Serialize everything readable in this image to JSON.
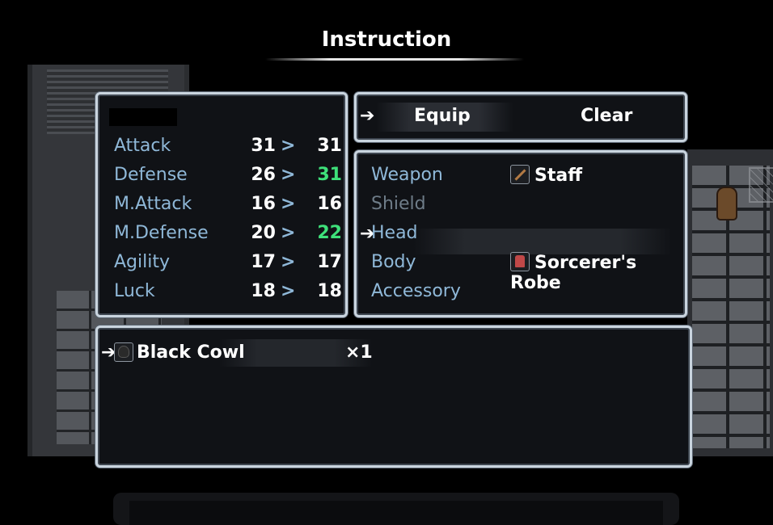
{
  "screen_title": "Instruction",
  "status": {
    "stats": [
      {
        "label": "Attack",
        "current": "31",
        "arrow": ">",
        "new": "31",
        "changed": false
      },
      {
        "label": "Defense",
        "current": "26",
        "arrow": ">",
        "new": "31",
        "changed": true
      },
      {
        "label": "M.Attack",
        "current": "16",
        "arrow": ">",
        "new": "16",
        "changed": false
      },
      {
        "label": "M.Defense",
        "current": "20",
        "arrow": ">",
        "new": "22",
        "changed": true
      },
      {
        "label": "Agility",
        "current": "17",
        "arrow": ">",
        "new": "17",
        "changed": false
      },
      {
        "label": "Luck",
        "current": "18",
        "arrow": ">",
        "new": "18",
        "changed": false
      }
    ],
    "increase_color": "#3ee07a"
  },
  "commands": {
    "equip": "Equip",
    "clear": "Clear",
    "selected": "Equip"
  },
  "slots": [
    {
      "label": "Weapon",
      "item": "Staff",
      "icon": "staff-icon",
      "enabled": true
    },
    {
      "label": "Shield",
      "item": "",
      "icon": "",
      "enabled": false
    },
    {
      "label": "Head",
      "item": "",
      "icon": "",
      "enabled": true
    },
    {
      "label": "Body",
      "item": "Sorcerer's Robe",
      "icon": "robe-icon",
      "enabled": true
    },
    {
      "label": "Accessory",
      "item": "",
      "icon": "",
      "enabled": true
    }
  ],
  "items": [
    {
      "name": "Black Cowl",
      "count": "×1",
      "icon": "cowl-icon"
    }
  ],
  "cursor_glyph": "➔",
  "colors": {
    "label_blue": "#8fb8d8",
    "window_border": "#c9d4de",
    "window_bg": "#101216"
  }
}
